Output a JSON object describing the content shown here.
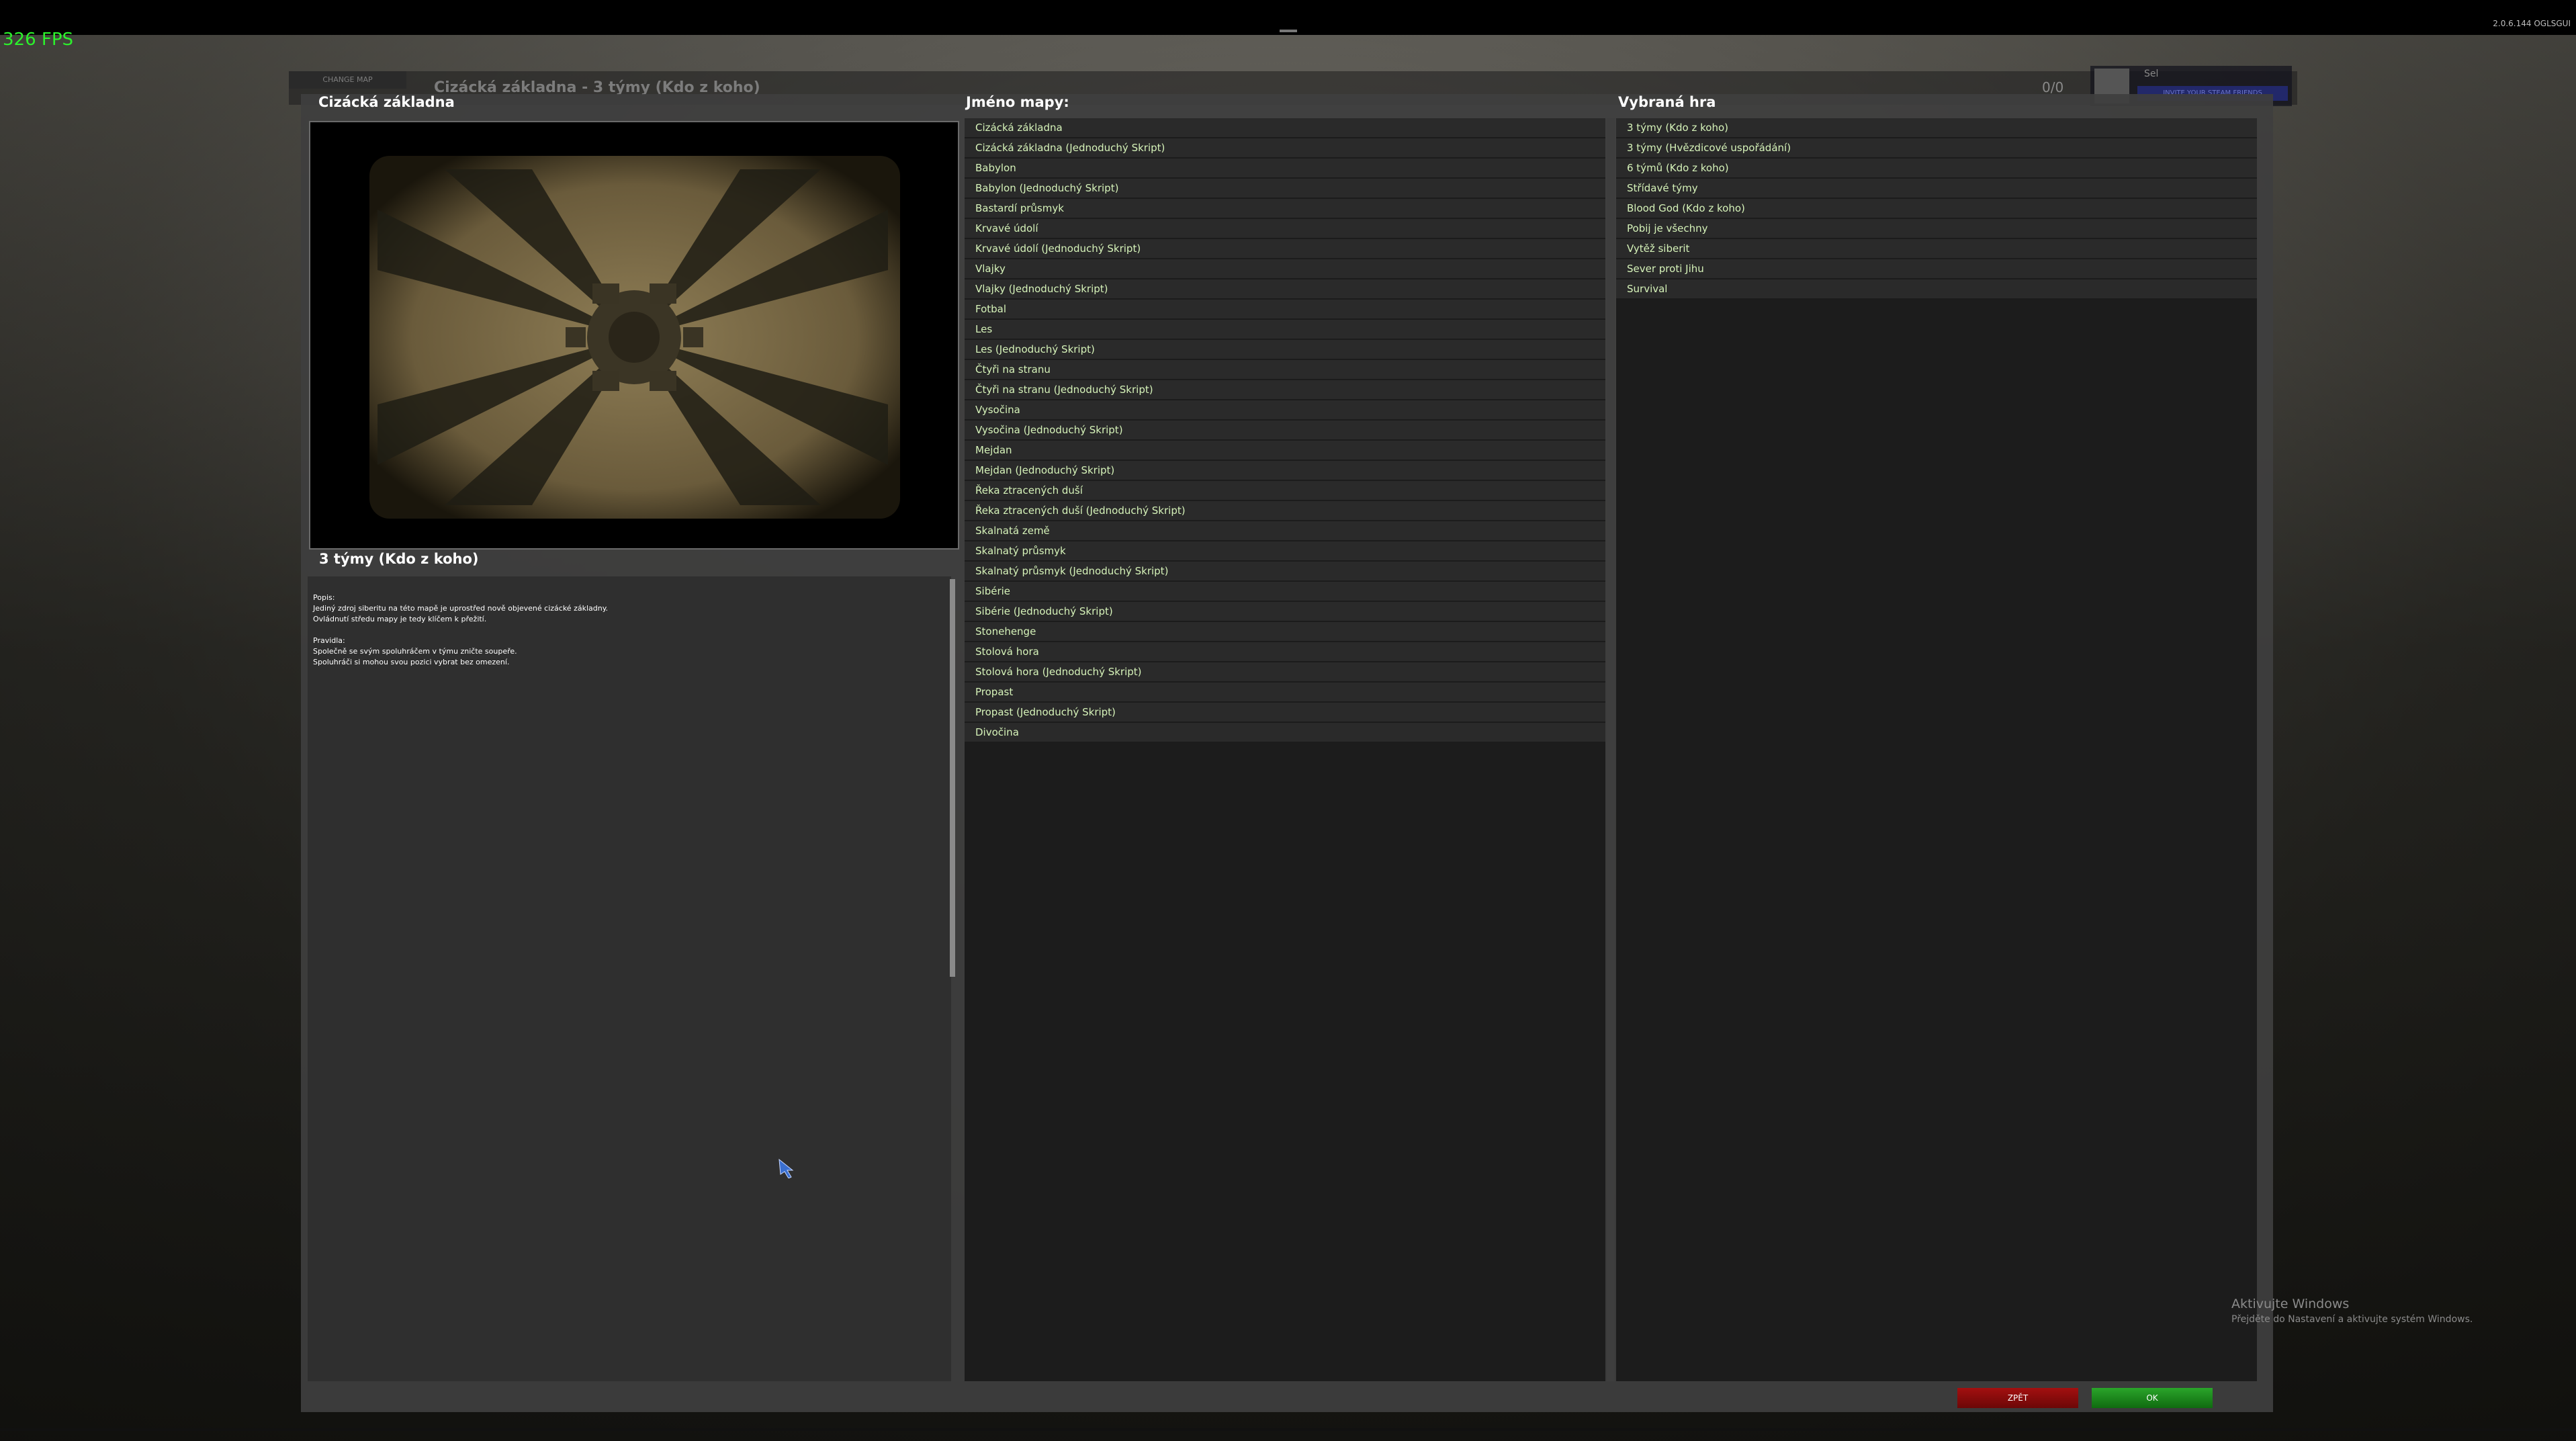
{
  "hud": {
    "fps": "326 FPS",
    "version": "2.0.6.144 OGLSGUI"
  },
  "lobby_ghost": {
    "change_map": "CHANGE MAP",
    "title": "Cizácká základna -  3 týmy (Kdo z koho)",
    "player_count": "0/0",
    "player_name": "Sel",
    "invite_label": "INVITE YOUR STEAM FRIENDS"
  },
  "map_panel": {
    "map_title": "Cizácká základna",
    "mode_title": "3 týmy (Kdo z koho)",
    "description": "Popis:\nJediný zdroj siberitu na této mapě je uprostřed nově objevené cizácké základny.\nOvládnutí středu mapy je tedy klíčem k přežití.\n\nPravidla:\nSpolečně se svým spoluhráčem v týmu zničte soupeře.\nSpoluhráči si mohou svou pozici vybrat bez omezení."
  },
  "maps_column": {
    "header": "Jméno mapy:",
    "items": [
      "Cizácká základna",
      "Cizácká základna (Jednoduchý Skript)",
      "Babylon",
      "Babylon (Jednoduchý Skript)",
      "Bastardí průsmyk",
      "Krvavé údolí",
      "Krvavé údolí (Jednoduchý Skript)",
      "Vlajky",
      "Vlajky (Jednoduchý Skript)",
      "Fotbal",
      "Les",
      "Les (Jednoduchý Skript)",
      "Čtyři na stranu",
      "Čtyři na stranu (Jednoduchý Skript)",
      "Vysočina",
      "Vysočina (Jednoduchý Skript)",
      "Mejdan",
      "Mejdan (Jednoduchý Skript)",
      "Řeka ztracených duší",
      "Řeka ztracených duší (Jednoduchý Skript)",
      "Skalnatá země",
      "Skalnatý průsmyk",
      "Skalnatý průsmyk (Jednoduchý Skript)",
      "Sibérie",
      "Sibérie (Jednoduchý Skript)",
      "Stonehenge",
      "Stolová hora",
      "Stolová hora (Jednoduchý Skript)",
      "Propast",
      "Propast (Jednoduchý Skript)",
      "Divočina"
    ]
  },
  "games_column": {
    "header": "Vybraná hra",
    "items": [
      "3 týmy (Kdo z koho)",
      "3 týmy (Hvězdicové uspořádání)",
      "6 týmů (Kdo z koho)",
      "Střídavé týmy",
      "Blood God (Kdo z koho)",
      "Pobij je všechny",
      "Vytěž siberit",
      "Sever proti Jihu",
      "Survival"
    ]
  },
  "buttons": {
    "back": "ZPĚT",
    "ok": "OK"
  },
  "watermark": {
    "line1": "Aktivujte Windows",
    "line2": "Přejděte do Nastavení a aktivujte systém Windows."
  },
  "colors": {
    "list_text": "#d6f3b9",
    "fps": "#2cf02c",
    "back_button": "#a31010",
    "ok_button": "#2aa52a"
  }
}
